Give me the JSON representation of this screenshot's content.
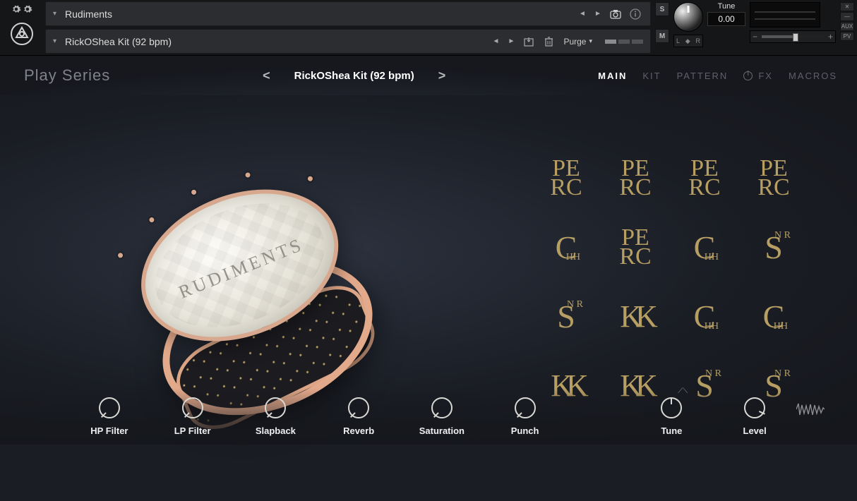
{
  "host": {
    "library_name": "Rudiments",
    "preset_name": "RickOShea Kit (92 bpm)",
    "purge_label": "Purge",
    "tune_label": "Tune",
    "tune_value": "0.00",
    "pan_left": "L",
    "pan_right": "R",
    "solo_letter": "S",
    "mute_letter": "M",
    "vol_minus": "−",
    "vol_plus": "+",
    "end_buttons": [
      "✕",
      "—",
      "AUX",
      "PV"
    ]
  },
  "nav": {
    "brand": "Play Series",
    "preset_display": "RickOShea Kit (92 bpm)",
    "tabs": {
      "main": "MAIN",
      "kit": "KIT",
      "pattern": "PATTERN",
      "fx": "FX",
      "macros": "MACROS"
    }
  },
  "drum_label": "RUDIMENTS",
  "pads": [
    {
      "id": "perc-1",
      "mono": "PE\nRC"
    },
    {
      "id": "perc-2",
      "mono": "PE\nRC"
    },
    {
      "id": "perc-3",
      "mono": "PE\nRC"
    },
    {
      "id": "perc-4",
      "mono": "PE\nRC"
    },
    {
      "id": "chh-1",
      "mono": "C",
      "sub": "HH"
    },
    {
      "id": "perc-5",
      "mono": "PE\nRC"
    },
    {
      "id": "chh-2",
      "mono": "C",
      "sub": "HH"
    },
    {
      "id": "snr-1",
      "mono": "S",
      "sub": "N R"
    },
    {
      "id": "snr-2",
      "mono": "S",
      "sub": "N R"
    },
    {
      "id": "kick-1",
      "mono": "KK"
    },
    {
      "id": "chh-3",
      "mono": "C",
      "sub": "HH"
    },
    {
      "id": "chh-4",
      "mono": "C",
      "sub": "HH"
    },
    {
      "id": "kick-2",
      "mono": "KK"
    },
    {
      "id": "kick-3",
      "mono": "KK"
    },
    {
      "id": "snr-3",
      "mono": "S",
      "sub": "N R"
    },
    {
      "id": "snr-4",
      "mono": "S",
      "sub": "N R"
    }
  ],
  "knobs": [
    {
      "label": "HP Filter"
    },
    {
      "label": "LP Filter"
    },
    {
      "label": "Slapback"
    },
    {
      "label": "Reverb"
    },
    {
      "label": "Saturation"
    },
    {
      "label": "Punch"
    },
    {
      "label": "Tune",
      "tune": true
    },
    {
      "label": "Level",
      "level": true
    }
  ]
}
